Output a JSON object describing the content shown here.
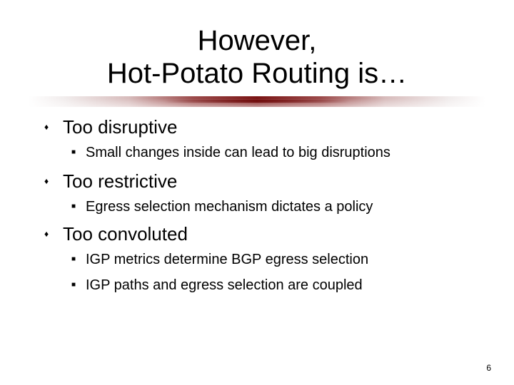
{
  "slide": {
    "title": {
      "line1": "However,",
      "line2": "Hot-Potato Routing is…"
    },
    "bullets": [
      {
        "text": "Too disruptive",
        "icon": "diamond-bullet-icon",
        "sub": [
          {
            "text": "Small changes inside can lead to big disruptions",
            "icon": "square-bullet-icon"
          }
        ]
      },
      {
        "text": "Too restrictive",
        "icon": "diamond-bullet-icon",
        "sub": [
          {
            "text": "Egress selection mechanism dictates a policy",
            "icon": "square-bullet-icon"
          }
        ]
      },
      {
        "text": "Too convoluted",
        "icon": "diamond-bullet-icon",
        "sub": [
          {
            "text": "IGP metrics determine BGP egress selection",
            "icon": "square-bullet-icon"
          },
          {
            "text": "IGP paths and egress selection are coupled",
            "icon": "square-bullet-icon"
          }
        ]
      }
    ],
    "bullet_glyphs": {
      "level1": "♦",
      "level2": "■"
    },
    "page_number": "6",
    "accent_color": "#7a1414"
  }
}
